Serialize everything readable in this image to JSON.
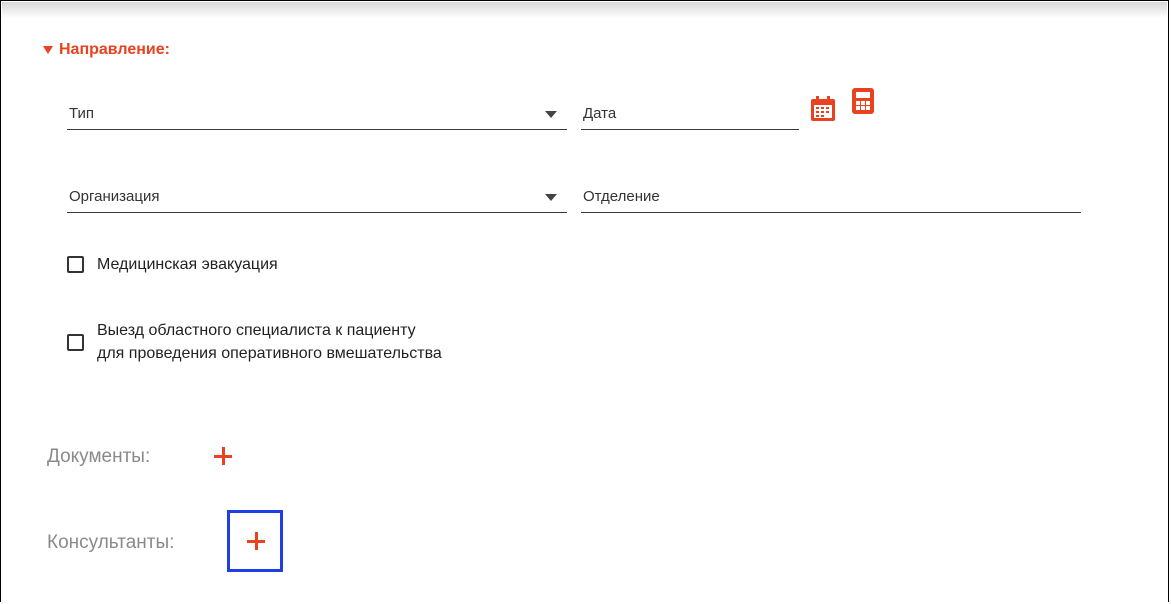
{
  "section": {
    "title": "Направление:"
  },
  "fields": {
    "type_label": "Тип",
    "date_label": "Дата",
    "organization_label": "Организация",
    "department_label": "Отделение"
  },
  "checkboxes": [
    {
      "label": "Медицинская эвакуация",
      "checked": false
    },
    {
      "label_line1": "Выезд областного специалиста к пациенту",
      "label_line2": "для проведения оперативного вмешательства",
      "checked": false
    }
  ],
  "documents": {
    "label": "Документы:"
  },
  "consultants": {
    "label": "Консультанты:"
  },
  "icons": {
    "section_toggle": "caret-down-icon",
    "date_picker": "calendar-icon",
    "date_calc": "calculator-icon",
    "add": "plus-icon"
  },
  "colors": {
    "accent": "#e8421e",
    "highlight": "#1e3ee8",
    "muted_label": "#8a8a8a"
  }
}
